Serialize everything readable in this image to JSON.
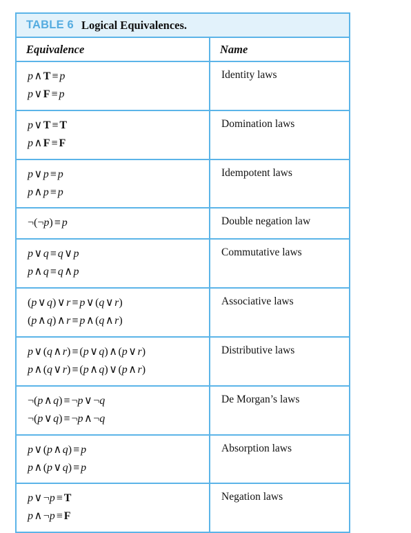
{
  "caption": {
    "label": "TABLE 6",
    "title": "Logical Equivalences.",
    "label_color": "#55ace0",
    "band_color": "#e2f2fb",
    "border_color": "#5bb4e8"
  },
  "columns": [
    {
      "key": "equivalence",
      "header": "Equivalence"
    },
    {
      "key": "name",
      "header": "Name"
    }
  ],
  "rows": [
    {
      "name": "Identity laws",
      "equivalences": [
        "p ∧ T ≡ p",
        "p ∨ F ≡ p"
      ],
      "parts": [
        [
          {
            "t": "v",
            "s": "p"
          },
          {
            "t": "op",
            "s": "∧"
          },
          {
            "t": "tv",
            "s": "T"
          },
          {
            "t": "eqv",
            "s": "≡"
          },
          {
            "t": "v",
            "s": "p"
          }
        ],
        [
          {
            "t": "v",
            "s": "p"
          },
          {
            "t": "op",
            "s": "∨"
          },
          {
            "t": "tv",
            "s": "F"
          },
          {
            "t": "eqv",
            "s": "≡"
          },
          {
            "t": "v",
            "s": "p"
          }
        ]
      ]
    },
    {
      "name": "Domination laws",
      "equivalences": [
        "p ∨ T ≡ T",
        "p ∧ F ≡ F"
      ],
      "parts": [
        [
          {
            "t": "v",
            "s": "p"
          },
          {
            "t": "op",
            "s": "∨"
          },
          {
            "t": "tv",
            "s": "T"
          },
          {
            "t": "eqv",
            "s": "≡"
          },
          {
            "t": "tv",
            "s": "T"
          }
        ],
        [
          {
            "t": "v",
            "s": "p"
          },
          {
            "t": "op",
            "s": "∧"
          },
          {
            "t": "tv",
            "s": "F"
          },
          {
            "t": "eqv",
            "s": "≡"
          },
          {
            "t": "tv",
            "s": "F"
          }
        ]
      ]
    },
    {
      "name": "Idempotent laws",
      "equivalences": [
        "p ∨ p ≡ p",
        "p ∧ p ≡ p"
      ],
      "parts": [
        [
          {
            "t": "v",
            "s": "p"
          },
          {
            "t": "op",
            "s": "∨"
          },
          {
            "t": "v",
            "s": "p"
          },
          {
            "t": "eqv",
            "s": "≡"
          },
          {
            "t": "v",
            "s": "p"
          }
        ],
        [
          {
            "t": "v",
            "s": "p"
          },
          {
            "t": "op",
            "s": "∧"
          },
          {
            "t": "v",
            "s": "p"
          },
          {
            "t": "eqv",
            "s": "≡"
          },
          {
            "t": "v",
            "s": "p"
          }
        ]
      ]
    },
    {
      "name": "Double negation law",
      "equivalences": [
        "¬(¬p) ≡ p"
      ],
      "parts": [
        [
          {
            "t": "neg",
            "s": "¬("
          },
          {
            "t": "neg",
            "s": "¬"
          },
          {
            "t": "v",
            "s": "p"
          },
          {
            "t": "par",
            "s": ")"
          },
          {
            "t": "eqv",
            "s": "≡"
          },
          {
            "t": "v",
            "s": "p"
          }
        ]
      ]
    },
    {
      "name": "Commutative laws",
      "equivalences": [
        "p ∨ q ≡ q ∨ p",
        "p ∧ q ≡ q ∧ p"
      ],
      "parts": [
        [
          {
            "t": "v",
            "s": "p"
          },
          {
            "t": "op",
            "s": "∨"
          },
          {
            "t": "v",
            "s": "q"
          },
          {
            "t": "eqv",
            "s": "≡"
          },
          {
            "t": "v",
            "s": "q"
          },
          {
            "t": "op",
            "s": "∨"
          },
          {
            "t": "v",
            "s": "p"
          }
        ],
        [
          {
            "t": "v",
            "s": "p"
          },
          {
            "t": "op",
            "s": "∧"
          },
          {
            "t": "v",
            "s": "q"
          },
          {
            "t": "eqv",
            "s": "≡"
          },
          {
            "t": "v",
            "s": "q"
          },
          {
            "t": "op",
            "s": "∧"
          },
          {
            "t": "v",
            "s": "p"
          }
        ]
      ]
    },
    {
      "name": "Associative laws",
      "equivalences": [
        "(p ∨ q) ∨ r ≡ p ∨ (q ∨ r)",
        "(p ∧ q) ∧ r ≡ p ∧ (q ∧ r)"
      ],
      "parts": [
        [
          {
            "t": "par",
            "s": "("
          },
          {
            "t": "v",
            "s": "p"
          },
          {
            "t": "op",
            "s": "∨"
          },
          {
            "t": "v",
            "s": "q"
          },
          {
            "t": "par",
            "s": ")"
          },
          {
            "t": "op",
            "s": "∨"
          },
          {
            "t": "v",
            "s": "r"
          },
          {
            "t": "eqv",
            "s": "≡"
          },
          {
            "t": "v",
            "s": "p"
          },
          {
            "t": "op",
            "s": "∨"
          },
          {
            "t": "par",
            "s": "("
          },
          {
            "t": "v",
            "s": "q"
          },
          {
            "t": "op",
            "s": "∨"
          },
          {
            "t": "v",
            "s": "r"
          },
          {
            "t": "par",
            "s": ")"
          }
        ],
        [
          {
            "t": "par",
            "s": "("
          },
          {
            "t": "v",
            "s": "p"
          },
          {
            "t": "op",
            "s": "∧"
          },
          {
            "t": "v",
            "s": "q"
          },
          {
            "t": "par",
            "s": ")"
          },
          {
            "t": "op",
            "s": "∧"
          },
          {
            "t": "v",
            "s": "r"
          },
          {
            "t": "eqv",
            "s": "≡"
          },
          {
            "t": "v",
            "s": "p"
          },
          {
            "t": "op",
            "s": "∧"
          },
          {
            "t": "par",
            "s": "("
          },
          {
            "t": "v",
            "s": "q"
          },
          {
            "t": "op",
            "s": "∧"
          },
          {
            "t": "v",
            "s": "r"
          },
          {
            "t": "par",
            "s": ")"
          }
        ]
      ]
    },
    {
      "name": "Distributive laws",
      "equivalences": [
        "p ∨ (q ∧ r) ≡ (p ∨ q) ∧ (p ∨ r)",
        "p ∧ (q ∨ r) ≡ (p ∧ q) ∨ (p ∧ r)"
      ],
      "parts": [
        [
          {
            "t": "v",
            "s": "p"
          },
          {
            "t": "op",
            "s": "∨"
          },
          {
            "t": "par",
            "s": "("
          },
          {
            "t": "v",
            "s": "q"
          },
          {
            "t": "op",
            "s": "∧"
          },
          {
            "t": "v",
            "s": "r"
          },
          {
            "t": "par",
            "s": ")"
          },
          {
            "t": "eqv",
            "s": "≡"
          },
          {
            "t": "par",
            "s": "("
          },
          {
            "t": "v",
            "s": "p"
          },
          {
            "t": "op",
            "s": "∨"
          },
          {
            "t": "v",
            "s": "q"
          },
          {
            "t": "par",
            "s": ")"
          },
          {
            "t": "op",
            "s": "∧"
          },
          {
            "t": "par",
            "s": "("
          },
          {
            "t": "v",
            "s": "p"
          },
          {
            "t": "op",
            "s": "∨"
          },
          {
            "t": "v",
            "s": "r"
          },
          {
            "t": "par",
            "s": ")"
          }
        ],
        [
          {
            "t": "v",
            "s": "p"
          },
          {
            "t": "op",
            "s": "∧"
          },
          {
            "t": "par",
            "s": "("
          },
          {
            "t": "v",
            "s": "q"
          },
          {
            "t": "op",
            "s": "∨"
          },
          {
            "t": "v",
            "s": "r"
          },
          {
            "t": "par",
            "s": ")"
          },
          {
            "t": "eqv",
            "s": "≡"
          },
          {
            "t": "par",
            "s": "("
          },
          {
            "t": "v",
            "s": "p"
          },
          {
            "t": "op",
            "s": "∧"
          },
          {
            "t": "v",
            "s": "q"
          },
          {
            "t": "par",
            "s": ")"
          },
          {
            "t": "op",
            "s": "∨"
          },
          {
            "t": "par",
            "s": "("
          },
          {
            "t": "v",
            "s": "p"
          },
          {
            "t": "op",
            "s": "∧"
          },
          {
            "t": "v",
            "s": "r"
          },
          {
            "t": "par",
            "s": ")"
          }
        ]
      ]
    },
    {
      "name": "De Morgan’s laws",
      "equivalences": [
        "¬(p ∧ q) ≡ ¬p ∨ ¬q",
        "¬(p ∨ q) ≡ ¬p ∧ ¬q"
      ],
      "parts": [
        [
          {
            "t": "neg",
            "s": "¬("
          },
          {
            "t": "v",
            "s": "p"
          },
          {
            "t": "op",
            "s": "∧"
          },
          {
            "t": "v",
            "s": "q"
          },
          {
            "t": "par",
            "s": ")"
          },
          {
            "t": "eqv",
            "s": "≡"
          },
          {
            "t": "neg",
            "s": "¬"
          },
          {
            "t": "v",
            "s": "p"
          },
          {
            "t": "op",
            "s": "∨"
          },
          {
            "t": "neg",
            "s": "¬"
          },
          {
            "t": "v",
            "s": "q"
          }
        ],
        [
          {
            "t": "neg",
            "s": "¬("
          },
          {
            "t": "v",
            "s": "p"
          },
          {
            "t": "op",
            "s": "∨"
          },
          {
            "t": "v",
            "s": "q"
          },
          {
            "t": "par",
            "s": ")"
          },
          {
            "t": "eqv",
            "s": "≡"
          },
          {
            "t": "neg",
            "s": "¬"
          },
          {
            "t": "v",
            "s": "p"
          },
          {
            "t": "op",
            "s": "∧"
          },
          {
            "t": "neg",
            "s": "¬"
          },
          {
            "t": "v",
            "s": "q"
          }
        ]
      ]
    },
    {
      "name": "Absorption laws",
      "equivalences": [
        "p ∨ (p ∧ q) ≡ p",
        "p ∧ (p ∨ q) ≡ p"
      ],
      "parts": [
        [
          {
            "t": "v",
            "s": "p"
          },
          {
            "t": "op",
            "s": "∨"
          },
          {
            "t": "par",
            "s": "("
          },
          {
            "t": "v",
            "s": "p"
          },
          {
            "t": "op",
            "s": "∧"
          },
          {
            "t": "v",
            "s": "q"
          },
          {
            "t": "par",
            "s": ")"
          },
          {
            "t": "eqv",
            "s": "≡"
          },
          {
            "t": "v",
            "s": "p"
          }
        ],
        [
          {
            "t": "v",
            "s": "p"
          },
          {
            "t": "op",
            "s": "∧"
          },
          {
            "t": "par",
            "s": "("
          },
          {
            "t": "v",
            "s": "p"
          },
          {
            "t": "op",
            "s": "∨"
          },
          {
            "t": "v",
            "s": "q"
          },
          {
            "t": "par",
            "s": ")"
          },
          {
            "t": "eqv",
            "s": "≡"
          },
          {
            "t": "v",
            "s": "p"
          }
        ]
      ]
    },
    {
      "name": "Negation laws",
      "equivalences": [
        "p ∨ ¬p ≡ T",
        "p ∧ ¬p ≡ F"
      ],
      "parts": [
        [
          {
            "t": "v",
            "s": "p"
          },
          {
            "t": "op",
            "s": "∨"
          },
          {
            "t": "neg",
            "s": "¬"
          },
          {
            "t": "v",
            "s": "p"
          },
          {
            "t": "eqv",
            "s": "≡"
          },
          {
            "t": "tv",
            "s": "T"
          }
        ],
        [
          {
            "t": "v",
            "s": "p"
          },
          {
            "t": "op",
            "s": "∧"
          },
          {
            "t": "neg",
            "s": "¬"
          },
          {
            "t": "v",
            "s": "p"
          },
          {
            "t": "eqv",
            "s": "≡"
          },
          {
            "t": "tv",
            "s": "F"
          }
        ]
      ]
    }
  ]
}
